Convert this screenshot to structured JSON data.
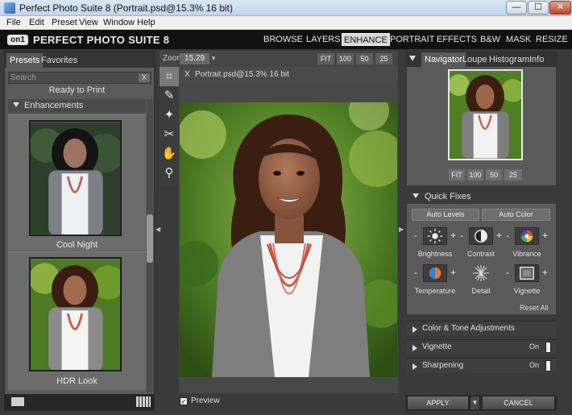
{
  "window": {
    "title": "Perfect Photo Suite 8 (Portrait.psd@15.3% 16 bit)",
    "controls": {
      "minimize": "—",
      "maximize": "☐",
      "close": "✕"
    }
  },
  "menu": [
    "File",
    "Edit",
    "Preset",
    "View",
    "Window",
    "Help"
  ],
  "app": {
    "logo_mark": "on1",
    "brand": "PERFECT PHOTO SUITE 8",
    "modules": [
      "BROWSE",
      "LAYERS",
      "ENHANCE",
      "PORTRAIT",
      "EFFECTS",
      "B&W",
      "MASK",
      "RESIZE"
    ],
    "active_module": "ENHANCE"
  },
  "left_panel": {
    "tabs": [
      "Presets",
      "Favorites"
    ],
    "active_tab": "Presets",
    "search": {
      "placeholder": "Search",
      "value": "",
      "clear": "X"
    },
    "previous_item": "Ready to Print",
    "group": "Enhancements",
    "presets": [
      {
        "name": "Cool Night"
      },
      {
        "name": "HDR Look"
      }
    ]
  },
  "toolbar": {
    "tools": [
      {
        "name": "crop-tool",
        "glyph": "⌗"
      },
      {
        "name": "retouch-brush-tool",
        "glyph": "✎"
      },
      {
        "name": "perfect-brush-tool",
        "glyph": "✦"
      },
      {
        "name": "clone-tool",
        "glyph": "✂"
      },
      {
        "name": "hand-tool",
        "glyph": "✋"
      },
      {
        "name": "zoom-tool",
        "glyph": "⚲"
      }
    ],
    "selected": 0
  },
  "canvas": {
    "zoom_label": "Zoom",
    "zoom_value": "15.29",
    "zoom_buttons": [
      "FIT",
      "100",
      "50",
      "25"
    ],
    "doc_tab": "Portrait.psd@15.3% 16 bit",
    "doc_close": "X",
    "preview_label": "Preview",
    "preview_checked": true
  },
  "right_panel": {
    "tabs": [
      "Navigator",
      "Loupe",
      "Histogram",
      "Info"
    ],
    "active_tab": "Navigator",
    "nav_buttons": [
      "FIT",
      "100",
      "50",
      "25"
    ],
    "quick_fixes": {
      "title": "Quick Fixes",
      "auto_levels": "Auto Levels",
      "auto_color": "Auto Color",
      "controls": [
        "Brightness",
        "Contrast",
        "Vibrance",
        "Temperature",
        "Detail",
        "Vignette"
      ],
      "minus": "-",
      "plus": "+",
      "reset": "Reset All"
    },
    "sections": [
      {
        "label": "Color & Tone Adjustments",
        "state": ""
      },
      {
        "label": "Vignette",
        "state": "On"
      },
      {
        "label": "Sharpening",
        "state": "On"
      }
    ],
    "apply": "APPLY",
    "cancel": "CANCEL"
  },
  "colors": {
    "panel_bg": "#5a5a5a",
    "header_bg": "#111111",
    "active_module_bg": "#d9d9d9",
    "photo_bg_green": "#3d6b1e",
    "cardigan_gray": "#7e7e7e",
    "necklace_coral": "#d0674f"
  }
}
